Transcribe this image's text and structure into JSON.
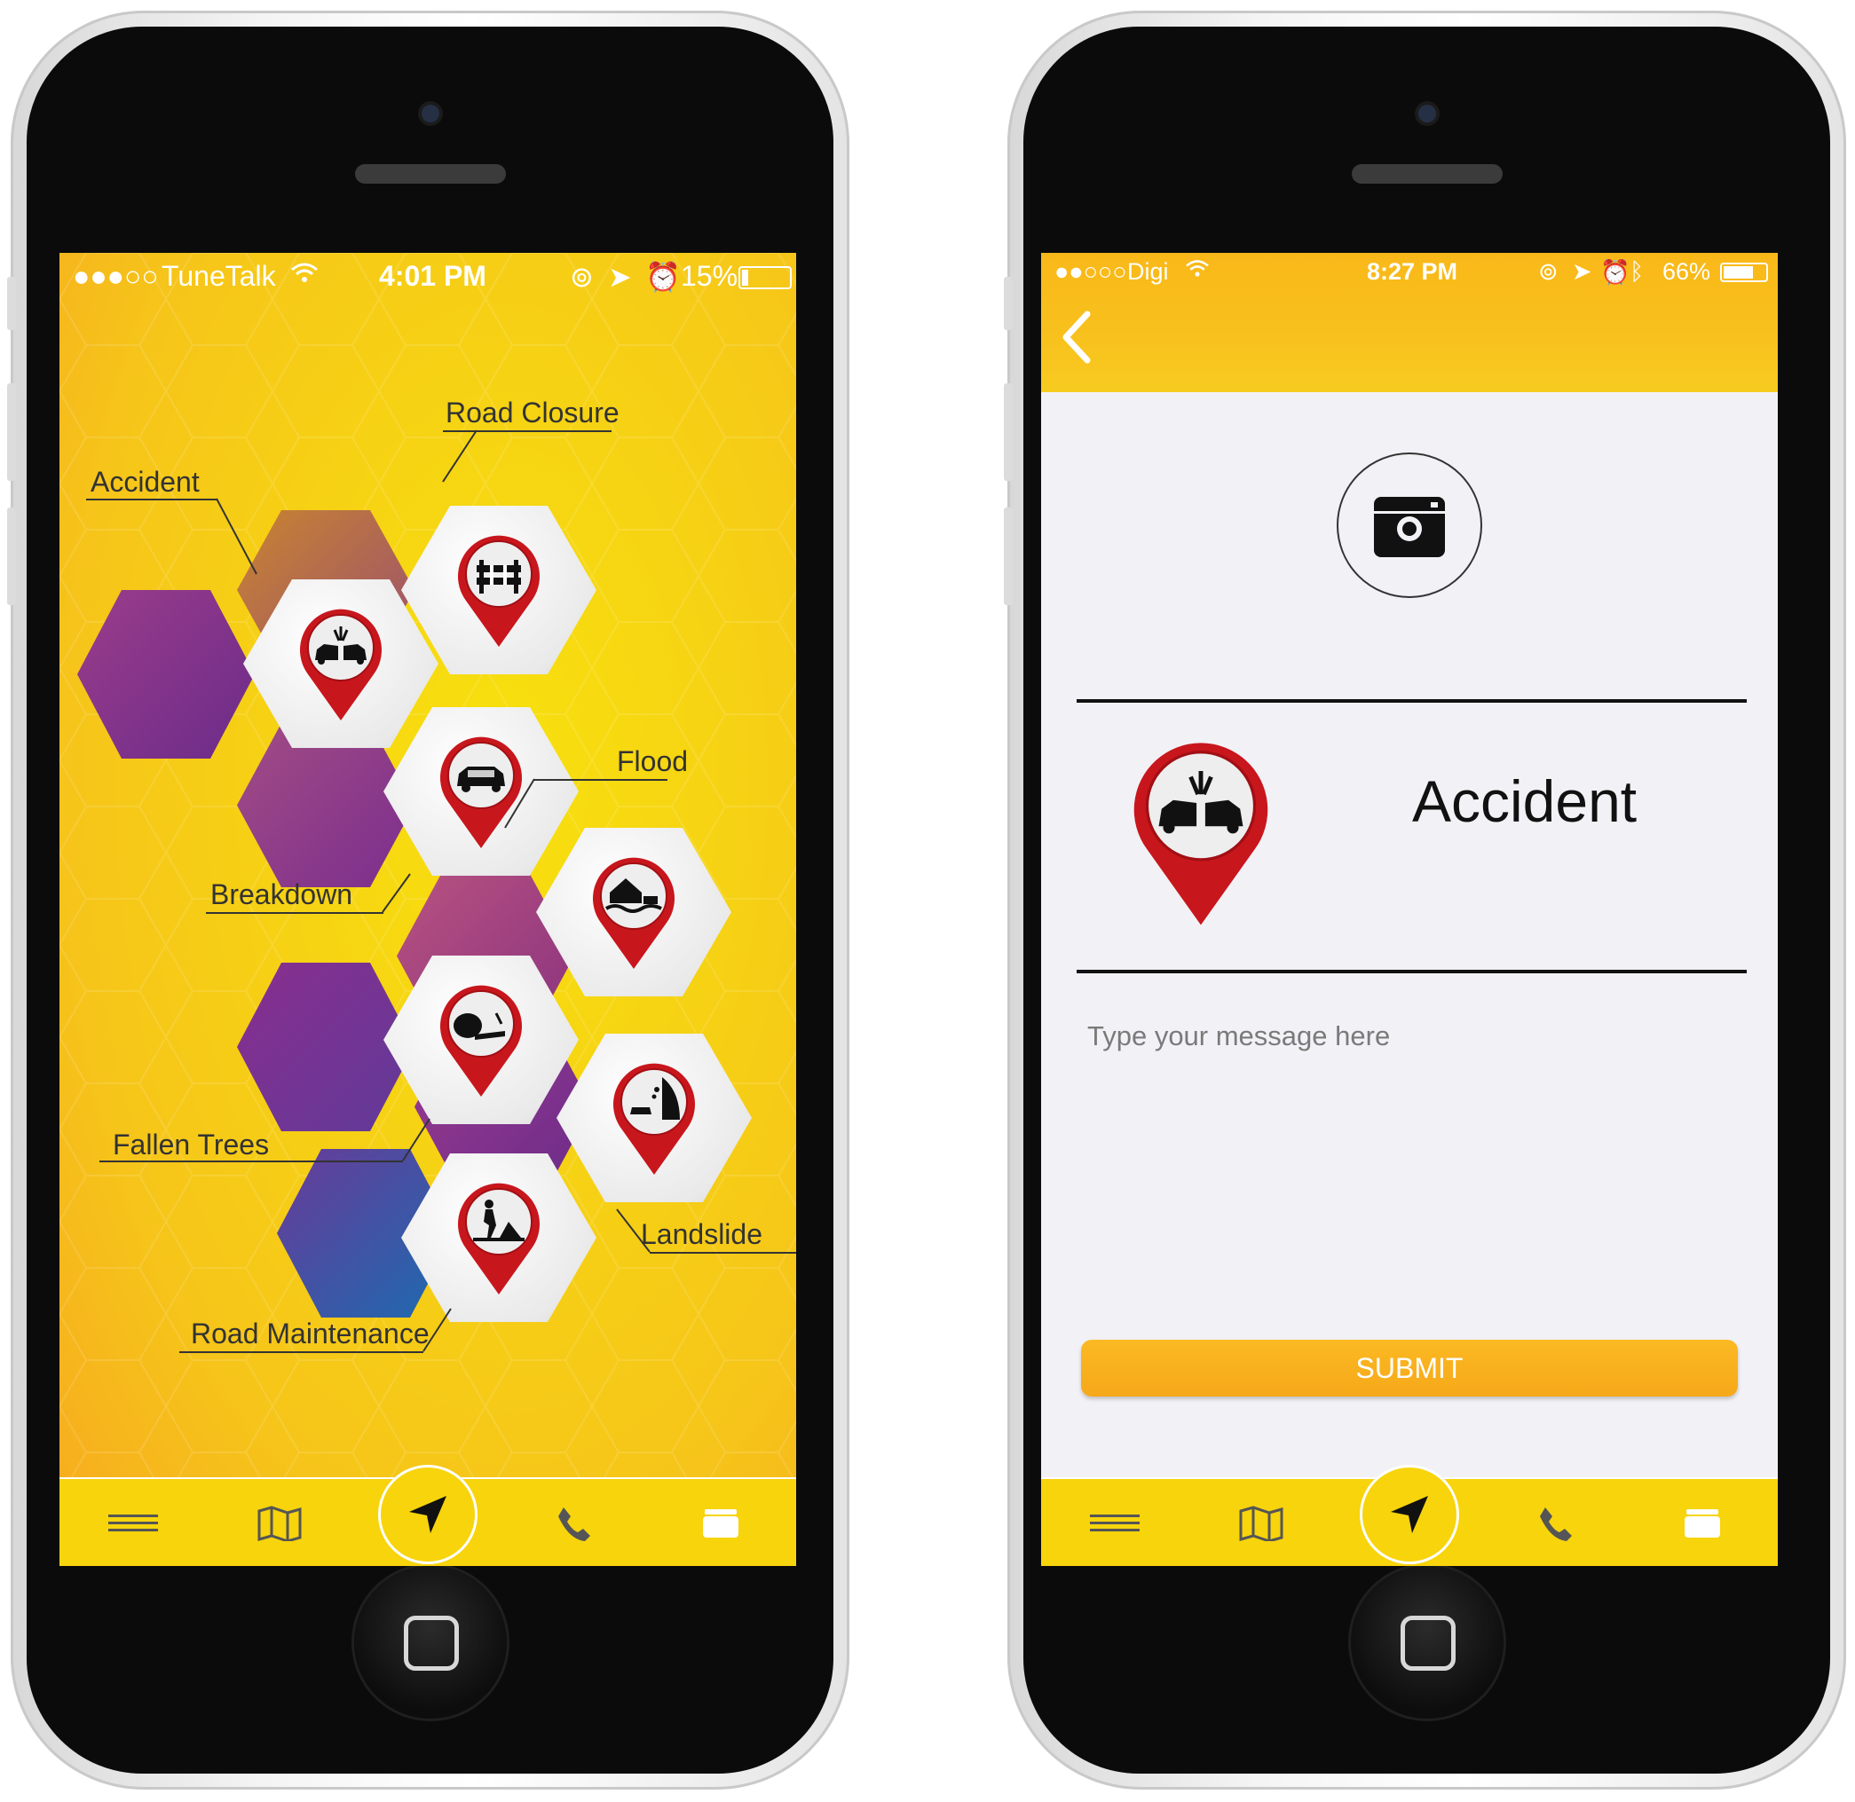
{
  "phone1": {
    "status": {
      "carrier": "TuneTalk",
      "time": "4:01 PM",
      "battery": "15%",
      "battery_level": 0.15
    },
    "categories": [
      {
        "label": "Road Closure",
        "icon": "road-barrier-icon"
      },
      {
        "label": "Accident",
        "icon": "car-crash-icon"
      },
      {
        "label": "Breakdown",
        "icon": "broken-car-icon"
      },
      {
        "label": "Flood",
        "icon": "flood-house-icon"
      },
      {
        "label": "Fallen Trees",
        "icon": "fallen-tree-icon"
      },
      {
        "label": "Landslide",
        "icon": "landslide-icon"
      },
      {
        "label": "Road Maintenance",
        "icon": "road-worker-icon"
      }
    ]
  },
  "phone2": {
    "status": {
      "carrier": "Digi",
      "time": "8:27 PM",
      "battery": "66%",
      "battery_level": 0.66
    },
    "selected_category": "Accident",
    "message": {
      "placeholder": "Type your message here"
    },
    "submit_label": "SUBMIT"
  },
  "tabbar": [
    "menu-icon",
    "map-icon",
    "navigation-arrow-icon",
    "phone-icon",
    "wallet-icon"
  ],
  "colors": {
    "accent_yellow": "#f7d40c",
    "accent_orange": "#f9b819",
    "pin_red": "#c8161d",
    "hex_purple": "#7b2e8e",
    "submit_orange": "#f6a81a"
  }
}
